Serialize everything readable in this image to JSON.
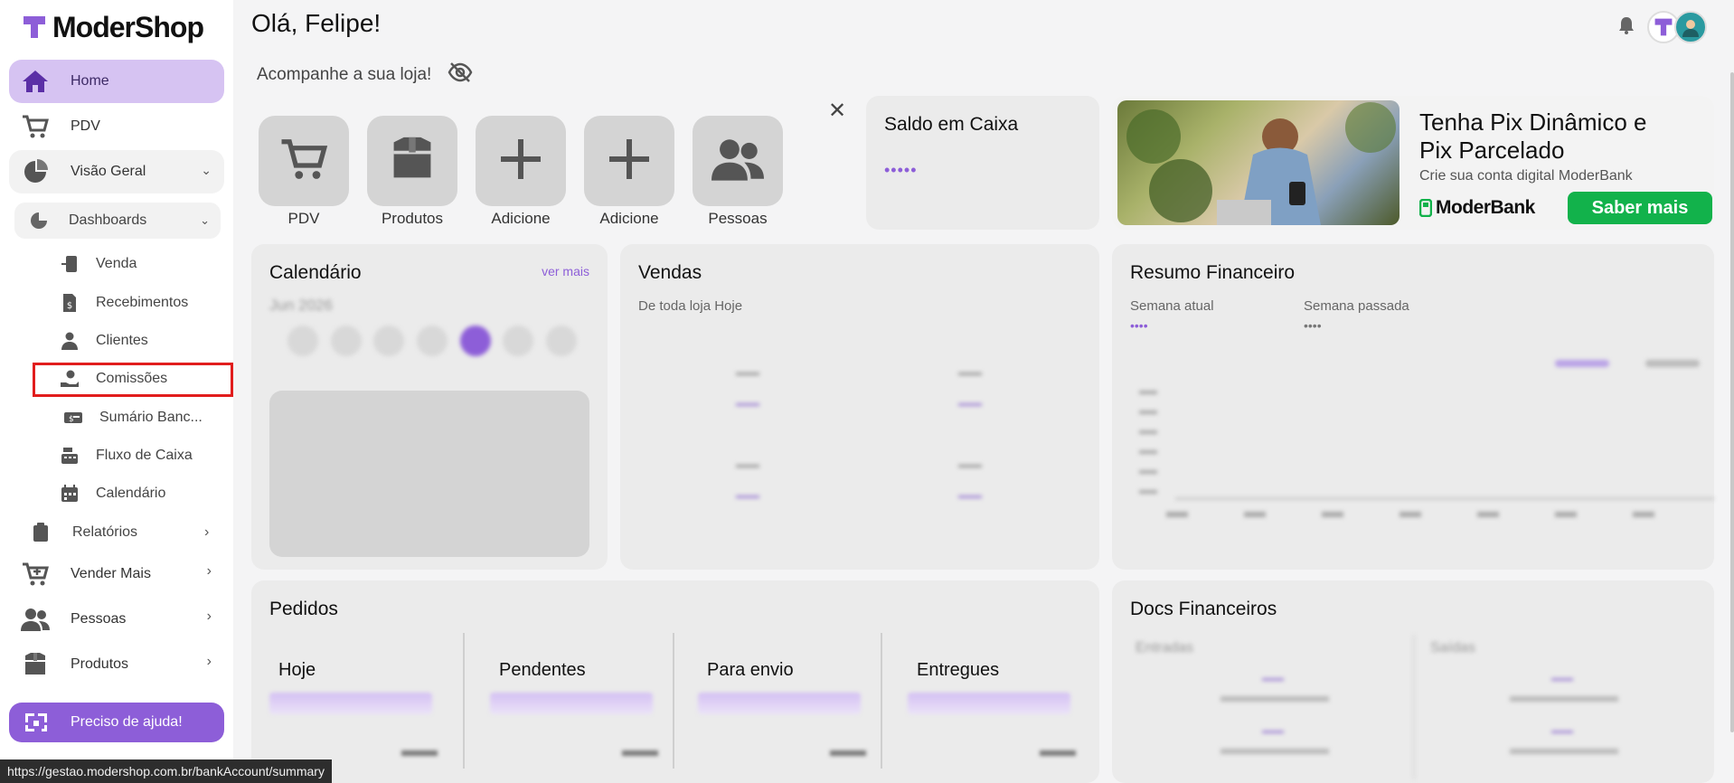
{
  "brand": {
    "name": "ModerShop"
  },
  "sidebar": {
    "home": "Home",
    "pdv": "PDV",
    "visao_geral": "Visão Geral",
    "dashboards": "Dashboards",
    "sub_items": [
      "Venda",
      "Recebimentos",
      "Clientes",
      "Comissões",
      "Sumário Banc...",
      "Fluxo de Caixa",
      "Calendário"
    ],
    "relatorios": "Relatórios",
    "vender_mais": "Vender Mais",
    "pessoas": "Pessoas",
    "produtos": "Produtos",
    "help": "Preciso de ajuda!"
  },
  "header": {
    "greeting": "Olá, Felipe!",
    "subtitle": "Acompanhe a sua loja!"
  },
  "quick_actions": [
    "PDV",
    "Produtos",
    "Adicione",
    "Adicione",
    "Pessoas"
  ],
  "saldo": {
    "title": "Saldo em Caixa",
    "value": "•••••"
  },
  "banner": {
    "headline_1": "Tenha Pix Dinâmico e",
    "headline_2": "Pix Parcelado",
    "subtext": "Crie sua conta digital ModerBank",
    "brand": "ModerBank",
    "cta": "Saber mais"
  },
  "calendar": {
    "title": "Calendário",
    "more": "ver mais",
    "month": "Jun 2026"
  },
  "vendas": {
    "title": "Vendas",
    "subtitle": "De toda loja Hoje"
  },
  "resumo": {
    "title": "Resumo Financeiro",
    "current_label": "Semana atual",
    "current_value": "••••",
    "previous_label": "Semana passada",
    "previous_value": "••••"
  },
  "pedidos": {
    "title": "Pedidos",
    "columns": [
      "Hoje",
      "Pendentes",
      "Para envio",
      "Entregues"
    ]
  },
  "docs": {
    "title": "Docs Financeiros",
    "col1": "Entradas",
    "col2": "Saídas"
  },
  "status_url": "https://gestao.modershop.com.br/bankAccount/summary",
  "colors": {
    "accent": "#8d5ed8",
    "active_nav": "#d6c3f2",
    "cta_green": "#12b24b",
    "highlight": "#e11d1d"
  }
}
